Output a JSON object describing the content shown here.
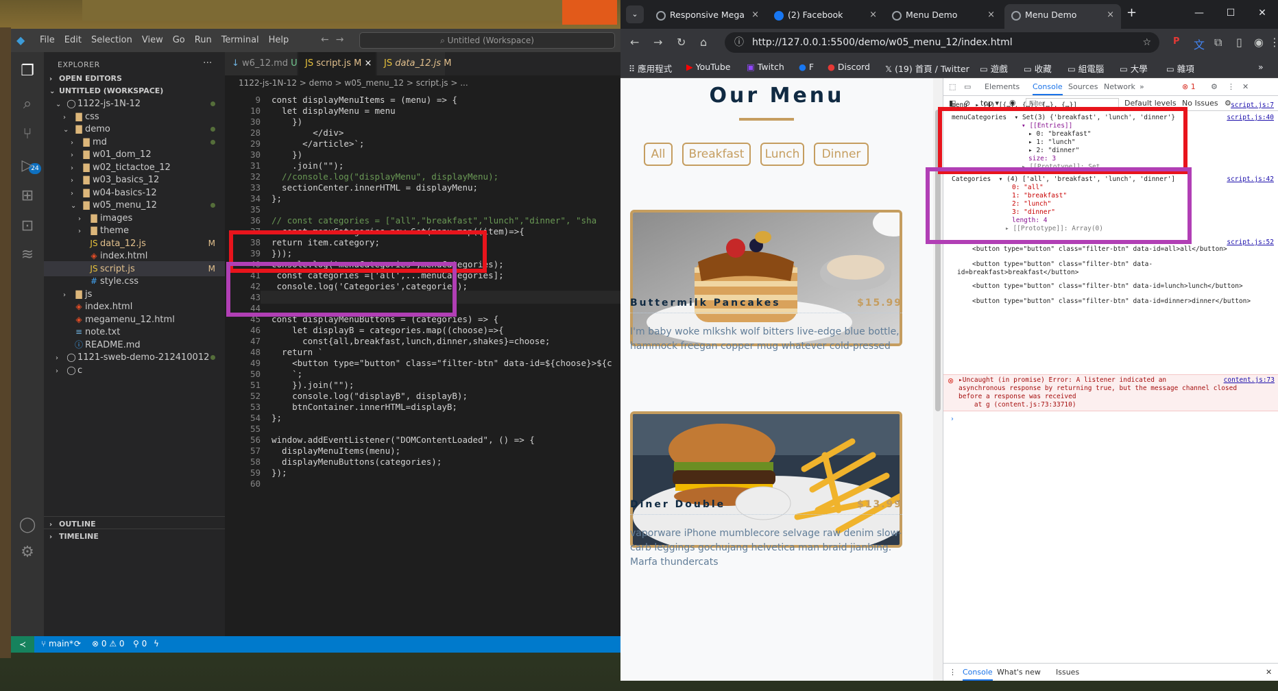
{
  "vscode": {
    "menu": [
      "File",
      "Edit",
      "Selection",
      "View",
      "Go",
      "Run",
      "Terminal",
      "Help"
    ],
    "search": "Untitled (Workspace)",
    "activity_badge": "24",
    "explorer_title": "EXPLORER",
    "open_editors": "OPEN EDITORS",
    "workspace": "UNTITLED (WORKSPACE)",
    "outline": "OUTLINE",
    "timeline": "TIMELINE",
    "tree": [
      {
        "label": "1122-js-1N-12",
        "indent": 1,
        "icon": "folder-root",
        "arrow": "v",
        "dot": true
      },
      {
        "label": "css",
        "indent": 2,
        "icon": "folder",
        "arrow": ">"
      },
      {
        "label": "demo",
        "indent": 2,
        "icon": "folder",
        "arrow": "v",
        "dot": true
      },
      {
        "label": "md",
        "indent": 3,
        "icon": "folder",
        "arrow": ">",
        "dot": true
      },
      {
        "label": "w01_dom_12",
        "indent": 3,
        "icon": "folder",
        "arrow": ">"
      },
      {
        "label": "w02_tictactoe_12",
        "indent": 3,
        "icon": "folder",
        "arrow": ">"
      },
      {
        "label": "w03_basics_12",
        "indent": 3,
        "icon": "folder",
        "arrow": ">"
      },
      {
        "label": "w04-basics-12",
        "indent": 3,
        "icon": "folder",
        "arrow": ">"
      },
      {
        "label": "w05_menu_12",
        "indent": 3,
        "icon": "folder",
        "arrow": "v",
        "dot": true
      },
      {
        "label": "images",
        "indent": 4,
        "icon": "folder",
        "arrow": ">"
      },
      {
        "label": "theme",
        "indent": 4,
        "icon": "folder",
        "arrow": ">"
      },
      {
        "label": "data_12.js",
        "indent": 4,
        "icon": "js",
        "status": "M"
      },
      {
        "label": "index.html",
        "indent": 4,
        "icon": "html"
      },
      {
        "label": "script.js",
        "indent": 4,
        "icon": "js",
        "status": "M",
        "selected": true
      },
      {
        "label": "style.css",
        "indent": 4,
        "icon": "css"
      },
      {
        "label": "js",
        "indent": 2,
        "icon": "folder",
        "arrow": ">"
      },
      {
        "label": "index.html",
        "indent": 2,
        "icon": "html"
      },
      {
        "label": "megamenu_12.html",
        "indent": 2,
        "icon": "html"
      },
      {
        "label": "note.txt",
        "indent": 2,
        "icon": "txt"
      },
      {
        "label": "README.md",
        "indent": 2,
        "icon": "info"
      },
      {
        "label": "1121-sweb-demo-212410012",
        "indent": 1,
        "icon": "folder-root",
        "arrow": ">",
        "dot": true
      },
      {
        "label": "c",
        "indent": 1,
        "icon": "folder-root",
        "arrow": ">"
      }
    ],
    "tabs": [
      {
        "label": "w6_12.md",
        "status": "U"
      },
      {
        "label": "script.js",
        "status": "M",
        "active": true
      },
      {
        "label": "data_12.js",
        "status": "M"
      }
    ],
    "breadcrumb": "1122-js-1N-12  >  demo  >  w05_menu_12  >  script.js  >  ...",
    "code": [
      {
        "n": "9",
        "t": "const displayMenuItems = (menu) => {"
      },
      {
        "n": "10",
        "t": "  let displayMenu = menu"
      },
      {
        "n": "30",
        "t": "    })"
      },
      {
        "n": "28",
        "t": "        </div>"
      },
      {
        "n": "29",
        "t": "      </article>`;"
      },
      {
        "n": "30",
        "t": "    })"
      },
      {
        "n": "31",
        "t": "    .join(\"\");"
      },
      {
        "n": "32",
        "t": "  //console.log(\"displayMenu\", displayMenu);"
      },
      {
        "n": "33",
        "t": "  sectionCenter.innerHTML = displayMenu;"
      },
      {
        "n": "34",
        "t": "};"
      },
      {
        "n": "35",
        "t": ""
      },
      {
        "n": "36",
        "t": "// const categories = [\"all\",\"breakfast\",\"lunch\",\"dinner\", \"sha"
      },
      {
        "n": "37",
        "t": "  const menuCategories=new Set(menu.map((item)=>{"
      },
      {
        "n": "38",
        "t": "return item.category;"
      },
      {
        "n": "39",
        "t": "}));"
      },
      {
        "n": "40",
        "t": "console.log('menuCategories',menuCategories);"
      },
      {
        "n": "41",
        "t": " const categories =['all',...menuCategories];"
      },
      {
        "n": "42",
        "t": " console.log('Categories',categories);"
      },
      {
        "n": "43",
        "t": ""
      },
      {
        "n": "44",
        "t": ""
      },
      {
        "n": "45",
        "t": "const displayMenuButtons = (categories) => {"
      },
      {
        "n": "46",
        "t": "    let displayB = categories.map((choose)=>{"
      },
      {
        "n": "47",
        "t": "      const{all,breakfast,lunch,dinner,shakes}=choose;"
      },
      {
        "n": "48",
        "t": "  return `"
      },
      {
        "n": "49",
        "t": "    <button type=\"button\" class=\"filter-btn\" data-id=${choose}>${c"
      },
      {
        "n": "50",
        "t": "    `;"
      },
      {
        "n": "51",
        "t": "    }).join(\"\");"
      },
      {
        "n": "52",
        "t": "    console.log(\"displayB\", displayB);"
      },
      {
        "n": "53",
        "t": "    btnContainer.innerHTML=displayB;"
      },
      {
        "n": "54",
        "t": "};"
      },
      {
        "n": "55",
        "t": ""
      },
      {
        "n": "56",
        "t": "window.addEventListener(\"DOMContentLoaded\", () => {"
      },
      {
        "n": "57",
        "t": "  displayMenuItems(menu);"
      },
      {
        "n": "58",
        "t": "  displayMenuButtons(categories);"
      },
      {
        "n": "59",
        "t": "});"
      },
      {
        "n": "60",
        "t": ""
      }
    ],
    "status": {
      "branch": "main*",
      "sync": "⟳",
      "problems": "⊗ 0 ⚠ 0",
      "ports": "⚲ 0"
    }
  },
  "browser": {
    "tabs": [
      {
        "label": "Responsive Mega"
      },
      {
        "label": "(2) Facebook"
      },
      {
        "label": "Menu Demo"
      },
      {
        "label": "Menu Demo",
        "active": true
      }
    ],
    "url": "http://127.0.0.1:5500/demo/w05_menu_12/index.html",
    "bookmarks": [
      "應用程式",
      "YouTube",
      "Twitch",
      "F",
      "Discord",
      "(19) 首頁 / Twitter",
      "遊戲",
      "收藏",
      "組電腦",
      "大學",
      "雜項"
    ]
  },
  "page": {
    "title": "Our Menu",
    "filters": [
      "All",
      "Breakfast",
      "Lunch",
      "Dinner"
    ],
    "items": [
      {
        "name": "Buttermilk Pancakes",
        "price": "$15.99",
        "desc": "I'm baby woke mlkshk wolf bitters live-edge blue bottle, hammock freegan copper mug whatever cold-pressed"
      },
      {
        "name": "Diner Double",
        "price": "$13.99",
        "desc": "vaporware iPhone mumblecore selvage raw denim slow-carb leggings gochujang helvetica man braid jianbing. Marfa thundercats"
      }
    ]
  },
  "devtools": {
    "tabs": [
      "Elements",
      "Console",
      "Sources",
      "Network"
    ],
    "error_count": "1",
    "context": "top",
    "filter_placeholder": "Filter",
    "levels": "Default levels",
    "issues": "No Issues",
    "logs": {
      "menu": "menu  ▸ (4) [{…}, {…}, {…}, {…}]",
      "menu_src": "script.js:7",
      "mc_head": "menuCategories  ▾ Set(3) {'breakfast', 'lunch', 'dinner'}",
      "mc_src": "script.js:40",
      "mc_entries": "▾ [[Entries]]",
      "mc_0": "▸ 0: \"breakfast\"",
      "mc_1": "▸ 1: \"lunch\"",
      "mc_2": "▸ 2: \"dinner\"",
      "mc_size": "size: 3",
      "mc_proto": "▸ [[Prototype]]: Set",
      "cat_head": "Categories  ▾ (4) ['all', 'breakfast', 'lunch', 'dinner']",
      "cat_src": "script.js:42",
      "cat_0": "0: \"all\"",
      "cat_1": "1: \"breakfast\"",
      "cat_2": "2: \"lunch\"",
      "cat_3": "3: \"dinner\"",
      "cat_len": "length: 4",
      "cat_proto": "▸ [[Prototype]]: Array(0)",
      "db_src": "script.js:52",
      "db_1": "<button type=\"button\" class=\"filter-btn\" data-id=all>all</button>",
      "db_2a": "<button type=\"button\" class=\"filter-btn\" data-",
      "db_2b": "id=breakfast>breakfast</button>",
      "db_3": "<button type=\"button\" class=\"filter-btn\" data-id=lunch>lunch</button>",
      "db_4": "<button type=\"button\" class=\"filter-btn\" data-id=dinner>dinner</button>",
      "err_1": "▸Uncaught (in promise) Error: A listener indicated an",
      "err_2": "asynchronous response by returning true, but the message channel closed",
      "err_3": "before a response was received",
      "err_4": "    at g (content.js:73:33710)",
      "err_src": "content.js:73",
      "prompt": "›"
    },
    "bottom_tabs": [
      "Console",
      "What's new",
      "Issues"
    ]
  }
}
